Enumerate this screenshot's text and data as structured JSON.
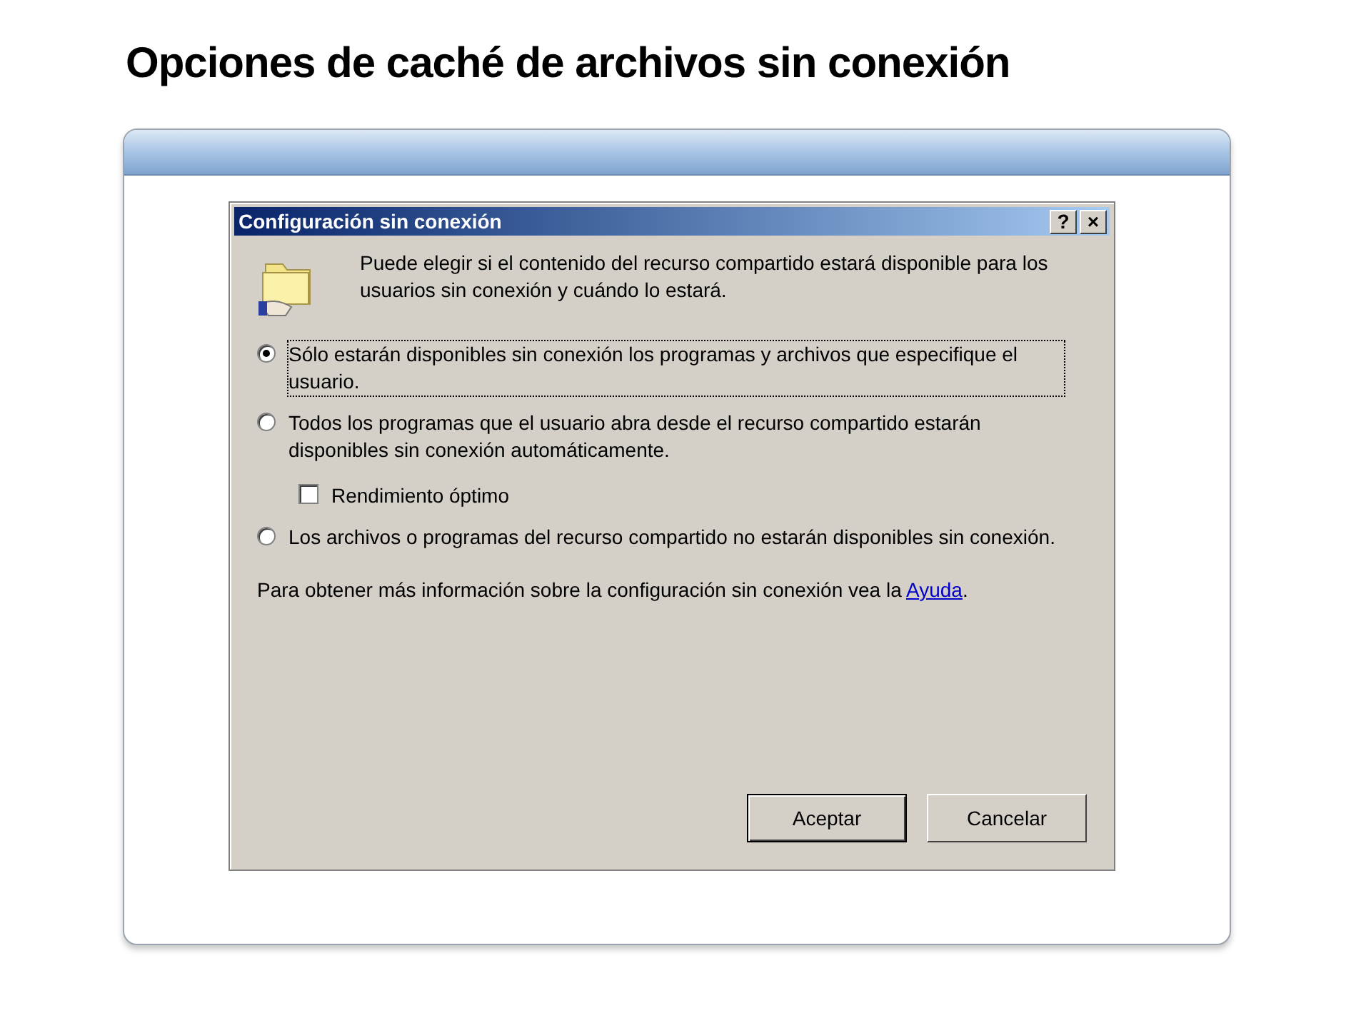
{
  "slide_title": "Opciones de caché de archivos sin conexión",
  "dialog": {
    "title": "Configuración sin conexión",
    "title_buttons": [
      "?",
      "×"
    ],
    "intro": "Puede elegir si el contenido del recurso compartido estará disponible para los usuarios sin conexión y cuándo lo estará.",
    "options": [
      {
        "kind": "radio",
        "label": "Sólo estarán disponibles sin conexión los programas y archivos que especifique el usuario.",
        "selected": true,
        "focused": true
      },
      {
        "kind": "radio",
        "label": "Todos los programas que el usuario abra desde el recurso compartido estarán disponibles sin conexión automáticamente.",
        "selected": false,
        "focused": false
      },
      {
        "kind": "checkbox",
        "label": "Rendimiento óptimo",
        "checked": false,
        "focused": false
      },
      {
        "kind": "radio",
        "label": "Los archivos o programas del recurso compartido no estarán disponibles sin conexión.",
        "selected": false,
        "focused": false
      }
    ],
    "help_text": "Para obtener más información sobre la configuración sin conexión vea la",
    "help_link": "Ayuda",
    "help_end": ".",
    "buttons": [
      {
        "label": "Aceptar",
        "default": true
      },
      {
        "label": "Cancelar",
        "default": false
      }
    ]
  }
}
